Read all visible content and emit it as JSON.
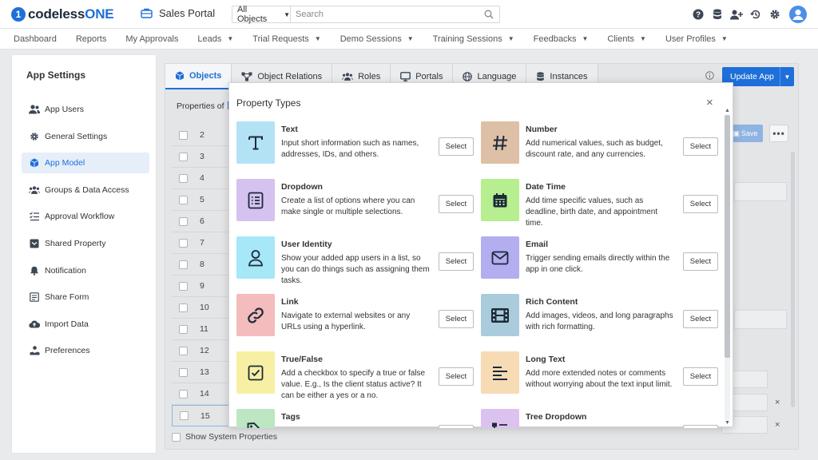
{
  "header": {
    "logo_mark": "1",
    "logo_text_a": "codeless",
    "logo_text_b": "ONE",
    "portal_name": "Sales Portal",
    "search_scope": "All Objects",
    "search_placeholder": "Search",
    "icons": [
      "help-icon",
      "database-icon",
      "add-user-icon",
      "history-icon",
      "gear-icon",
      "avatar"
    ]
  },
  "nav": [
    {
      "label": "Dashboard",
      "dropdown": false
    },
    {
      "label": "Reports",
      "dropdown": false
    },
    {
      "label": "My Approvals",
      "dropdown": false
    },
    {
      "label": "Leads",
      "dropdown": true
    },
    {
      "label": "Trial Requests",
      "dropdown": true
    },
    {
      "label": "Demo Sessions",
      "dropdown": true
    },
    {
      "label": "Training Sessions",
      "dropdown": true
    },
    {
      "label": "Feedbacks",
      "dropdown": true
    },
    {
      "label": "Clients",
      "dropdown": true
    },
    {
      "label": "User Profiles",
      "dropdown": true
    }
  ],
  "sidebar": {
    "title": "App Settings",
    "items": [
      {
        "label": "App Users",
        "icon": "users-icon"
      },
      {
        "label": "General Settings",
        "icon": "gear-icon"
      },
      {
        "label": "App Model",
        "icon": "cube-icon",
        "active": true
      },
      {
        "label": "Groups & Data Access",
        "icon": "group-icon"
      },
      {
        "label": "Approval Workflow",
        "icon": "checklist-icon"
      },
      {
        "label": "Shared Property",
        "icon": "shared-box-icon"
      },
      {
        "label": "Notification",
        "icon": "bell-icon"
      },
      {
        "label": "Share Form",
        "icon": "form-icon"
      },
      {
        "label": "Import Data",
        "icon": "cloud-upload-icon"
      },
      {
        "label": "Preferences",
        "icon": "preferences-icon"
      }
    ]
  },
  "main": {
    "tabs": [
      {
        "label": "Objects",
        "icon": "cube-icon",
        "active": true
      },
      {
        "label": "Object Relations",
        "icon": "relations-icon"
      },
      {
        "label": "Roles",
        "icon": "group-icon"
      },
      {
        "label": "Portals",
        "icon": "monitor-icon"
      },
      {
        "label": "Language",
        "icon": "globe-icon"
      },
      {
        "label": "Instances",
        "icon": "database-icon"
      }
    ],
    "update_button": "Update App",
    "properties_label": "Properties of",
    "save_label": "Save",
    "more_label": "•••",
    "row_numbers": [
      "2",
      "3",
      "4",
      "5",
      "6",
      "7",
      "8",
      "9",
      "10",
      "11",
      "12",
      "13",
      "14",
      "15"
    ],
    "show_system_properties": "Show System Properties",
    "remove_mark": "×"
  },
  "modal": {
    "title": "Property Types",
    "close_label": "×",
    "select_label": "Select",
    "types": [
      {
        "name": "Text",
        "description": "Input short information such as names, addresses, IDs, and others.",
        "icon": "text-icon",
        "color": "#b4e2f5"
      },
      {
        "name": "Number",
        "description": "Add numerical values, such as budget, discount rate, and any currencies.",
        "icon": "hash-icon",
        "color": "#ddc0a6"
      },
      {
        "name": "Dropdown",
        "description": "Create a list of options where you can make single or multiple selections.",
        "icon": "list-icon",
        "color": "#d5c2ef"
      },
      {
        "name": "Date Time",
        "description": "Add time specific values, such as deadline, birth date, and appointment time.",
        "icon": "calendar-icon",
        "color": "#b7ee8f"
      },
      {
        "name": "User Identity",
        "description": "Show your added app users in a list, so you can do things such as assigning them tasks.",
        "icon": "user-icon",
        "color": "#a6e7f8"
      },
      {
        "name": "Email",
        "description": "Trigger sending emails directly within the app in one click.",
        "icon": "envelope-icon",
        "color": "#b3aef0"
      },
      {
        "name": "Link",
        "description": "Navigate to external websites or any URLs using a hyperlink.",
        "icon": "link-icon",
        "color": "#f4bcbc"
      },
      {
        "name": "Rich Content",
        "description": "Add images, videos, and long paragraphs with rich formatting.",
        "icon": "film-icon",
        "color": "#a9cbdc"
      },
      {
        "name": "True/False",
        "description": "Add a checkbox to specify a true or false value. E.g., Is the client status active? It can be either a yes or a no.",
        "icon": "checkbox-icon",
        "color": "#f7f0a4"
      },
      {
        "name": "Long Text",
        "description": "Add more extended notes or comments without worrying about the text input limit.",
        "icon": "paragraph-icon",
        "color": "#f6dbb4"
      },
      {
        "name": "Tags",
        "description": "",
        "icon": "tag-icon",
        "color": "#bde6c2"
      },
      {
        "name": "Tree Dropdown",
        "description": "",
        "icon": "tree-icon",
        "color": "#dcc2ef"
      }
    ]
  }
}
